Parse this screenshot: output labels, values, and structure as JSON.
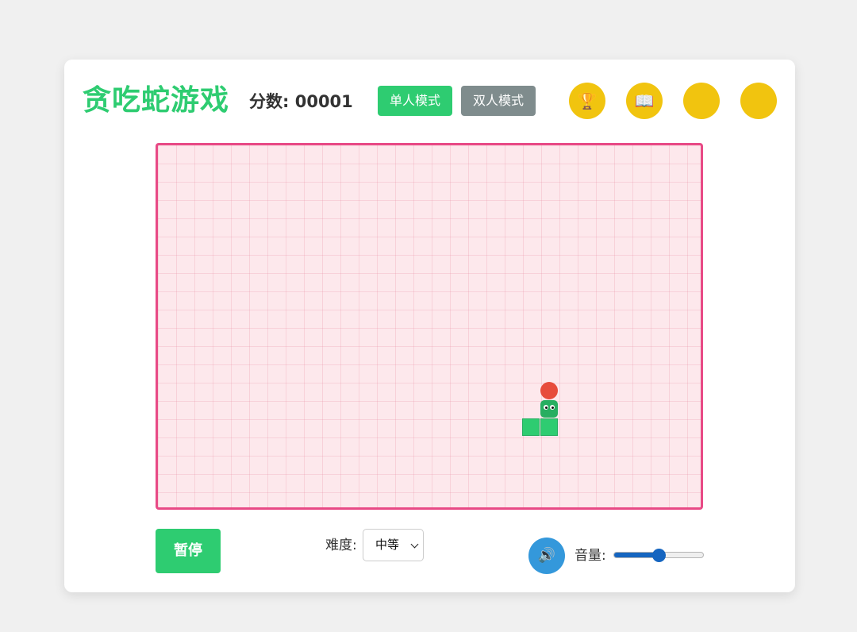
{
  "header": {
    "title": "贪吃蛇游戏",
    "score_label": "分数:",
    "score_value": "00001"
  },
  "modes": {
    "single_label": "单人模式",
    "double_label": "双人模式",
    "active": "single"
  },
  "icon_buttons": [
    {
      "name": "trophy-icon",
      "glyph": "🏆"
    },
    {
      "name": "book-icon",
      "glyph": "📖"
    },
    {
      "name": "blank-circle-icon",
      "glyph": ""
    },
    {
      "name": "blank-circle-icon",
      "glyph": ""
    }
  ],
  "board": {
    "columns": 30,
    "rows": 20,
    "snake": [
      {
        "col": 21,
        "row": 14,
        "part": "head"
      },
      {
        "col": 21,
        "row": 15,
        "part": "body"
      },
      {
        "col": 20,
        "row": 15,
        "part": "body"
      }
    ],
    "food": {
      "col": 21,
      "row": 13
    }
  },
  "controls": {
    "pause_label": "暂停",
    "difficulty_label": "难度:",
    "difficulty_value": "中等",
    "sound_icon": "🔊",
    "volume_label": "音量:",
    "volume_fraction": 0.5
  },
  "colors": {
    "title": "#2ecc71",
    "single_mode": "#2ecc71",
    "double_mode": "#7f8c8d",
    "circle_buttons": "#f1c40f",
    "board_border": "#e84a86",
    "board_bg": "#fde8ec",
    "snake": "#2ecc71",
    "food": "#e74c3c",
    "sound_button": "#3498db",
    "slider": "#1565c0"
  }
}
